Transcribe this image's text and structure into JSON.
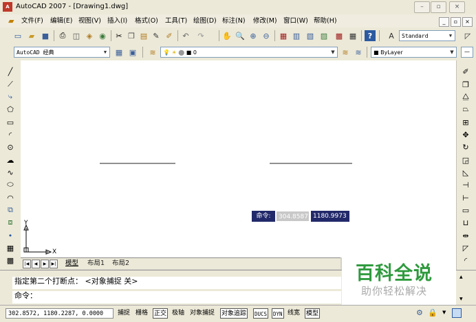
{
  "window": {
    "title": "AutoCAD 2007 - [Drawing1.dwg]",
    "app_icon_text": "A"
  },
  "menu": {
    "items": [
      "文件(F)",
      "编辑(E)",
      "视图(V)",
      "插入(I)",
      "格式(O)",
      "工具(T)",
      "绘图(D)",
      "标注(N)",
      "修改(M)",
      "窗口(W)",
      "帮助(H)"
    ]
  },
  "toolbar": {
    "text_style": "Standard",
    "workspace": "AutoCAD 经典",
    "layer": "0",
    "color": "ByLayer"
  },
  "canvas": {
    "ucs_y": "Y",
    "ucs_x": "X",
    "dynamic_input": {
      "label": "命令:",
      "x_value": "304.8587",
      "y_value": "1180.9973"
    }
  },
  "layout_tabs": [
    "模型",
    "布局1",
    "布局2"
  ],
  "command_line": {
    "history": "指定第二个打断点：  <对象捕捉 关>",
    "prompt": "命令："
  },
  "status_bar": {
    "coordinates": "302.8572, 1180.2287, 0.0000",
    "toggles": [
      {
        "label": "捕捉",
        "on": false
      },
      {
        "label": "栅格",
        "on": false
      },
      {
        "label": "正交",
        "on": true
      },
      {
        "label": "极轴",
        "on": false
      },
      {
        "label": "对象捕捉",
        "on": false
      },
      {
        "label": "对象追踪",
        "on": true
      },
      {
        "label": "DUCS",
        "on": true
      },
      {
        "label": "DYN",
        "on": true
      },
      {
        "label": "线宽",
        "on": false
      },
      {
        "label": "模型",
        "on": true
      }
    ]
  },
  "watermark": {
    "title": "百科全说",
    "subtitle": "助你轻松解决"
  },
  "colors": {
    "watermark_green": "#2f9a3e",
    "dyn_bg": "#22296a",
    "dyn_field": "#c8c8c8"
  }
}
